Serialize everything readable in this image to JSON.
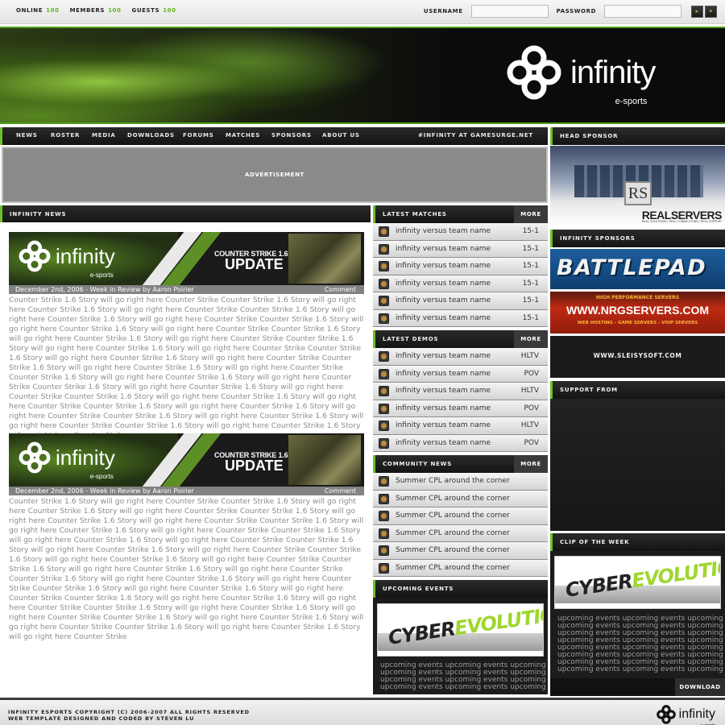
{
  "stats": {
    "online_label": "ONLINE",
    "online": "100",
    "members_label": "MEMBERS",
    "members": "100",
    "guests_label": "GUESTS",
    "guests": "100"
  },
  "login": {
    "username_label": "USERNAME",
    "password_label": "PASSWORD"
  },
  "brand": {
    "name": "infinity",
    "tagline": "e-sports"
  },
  "nav": {
    "items": [
      "NEWS",
      "ROSTER",
      "MEDIA",
      "DOWNLOADS",
      "FORUMS",
      "MATCHES",
      "SPONSORS",
      "ABOUT US"
    ],
    "irc": "#INFINITY AT GAMESURGE.NET"
  },
  "ad": {
    "label": "ADVERTISEMENT"
  },
  "news": {
    "header": "INFINITY NEWS",
    "story_banner": {
      "game": "COUNTER STRIKE 1.6",
      "kind": "UPDATE"
    },
    "stories": [
      {
        "meta": "December 2nd, 2006 - Week in Review by Aaron Poirier",
        "comment": "Comment"
      },
      {
        "meta": "December 2nd, 2006 - Week in Review by Aaron Poirier",
        "comment": "Comment"
      }
    ],
    "body": "Counter Strike 1.6 Story will go right here Counter Strike Counter Strike 1.6 Story will go right here Counter Strike 1.6 Story will go right here Counter Strike Counter Strike 1.6 Story will go right here Counter Strike 1.6 Story will go right here Counter Strike Counter Strike 1.6 Story will go right here Counter Strike 1.6 Story will go right here Counter Strike Counter Strike 1.6 Story will go right here Counter Strike 1.6 Story will go right here Counter Strike Counter Strike 1.6 Story will go right here Counter Strike 1.6 Story will go right here Counter Strike Counter Strike 1.6 Story will go right here Counter Strike 1.6 Story will go right here Counter Strike Counter Strike 1.6 Story will go right here Counter Strike 1.6 Story will go right here Counter Strike Counter Strike 1.6 Story will go right here Counter Strike 1.6 Story will go right here Counter Strike Counter Strike 1.6 Story will go right here Counter Strike 1.6 Story will go right here Counter Strike Counter Strike 1.6 Story will go right here Counter Strike 1.6 Story will go right here Counter Strike Counter Strike 1.6 Story will go right here Counter Strike 1.6 Story will go right here Counter Strike Counter Strike 1.6 Story will go right here Counter Strike 1.6 Story will go right here Counter Strike Counter Strike 1.6 Story will go right here Counter Strike 1.6 Story will go right here Counter Strike"
  },
  "matches": {
    "header": "LATEST MATCHES",
    "more": "MORE",
    "rows": [
      {
        "label": "infinity versus team name",
        "value": "15-1"
      },
      {
        "label": "infinity versus team name",
        "value": "15-1"
      },
      {
        "label": "infinity versus team name",
        "value": "15-1"
      },
      {
        "label": "infinity versus team name",
        "value": "15-1"
      },
      {
        "label": "infinity versus team name",
        "value": "15-1"
      },
      {
        "label": "infinity versus team name",
        "value": "15-1"
      }
    ]
  },
  "demos": {
    "header": "LATEST DEMOS",
    "more": "MORE",
    "rows": [
      {
        "label": "infinity versus team name",
        "value": "HLTV"
      },
      {
        "label": "infinity versus team name",
        "value": "POV"
      },
      {
        "label": "infinity versus team name",
        "value": "HLTV"
      },
      {
        "label": "infinity versus team name",
        "value": "POV"
      },
      {
        "label": "infinity versus team name",
        "value": "HLTV"
      },
      {
        "label": "infinity versus team name",
        "value": "POV"
      }
    ]
  },
  "community": {
    "header": "COMMUNITY NEWS",
    "more": "MORE",
    "rows": [
      {
        "label": "Summer CPL around the corner"
      },
      {
        "label": "Summer CPL around the corner"
      },
      {
        "label": "Summer CPL around the corner"
      },
      {
        "label": "Summer CPL around the corner"
      },
      {
        "label": "Summer CPL around the corner"
      },
      {
        "label": "Summer CPL around the corner"
      }
    ]
  },
  "events": {
    "header": "UPCOMING EVENTS",
    "image_text_a": "CYBER",
    "image_text_b": "EVOLUTION",
    "lines": [
      "upcoming events upcoming events upcoming",
      "upcoming events upcoming events upcoming",
      "upcoming events upcoming events upcoming",
      "upcoming events upcoming events upcoming"
    ]
  },
  "sidebar": {
    "head_sponsor": "HEAD SPONSOR",
    "head_sponsor_name": "REALSERVERS",
    "head_sponsor_tag": "REAL SOLUTIONS / REAL CONNECTIONS / REAL SUPPORT",
    "sponsors_header": "INFINITY SPONSORS",
    "battlepad": "BATTLEPAD",
    "nrg_top": "HIGH PERFORMANCE SERVERS",
    "nrg": "WWW.NRGSERVERS.COM",
    "nrg_sub": "WEB HOSTING - GAME SERVERS - VOIP SERVERS",
    "sleisy": "WWW.SLEISYSOFT.COM",
    "support_header": "SUPPORT FROM",
    "clip_header": "CLIP OF THE WEEK",
    "clip_lines": [
      "upcoming events upcoming events upcoming",
      "upcoming events upcoming events upcoming",
      "upcoming events upcoming events upcoming",
      "upcoming events upcoming events upcoming",
      "upcoming events upcoming events upcoming",
      "upcoming events upcoming events upcoming",
      "upcoming events upcoming events upcoming",
      "upcoming events upcoming events upcoming"
    ],
    "download": "DOWNLOAD"
  },
  "footer": {
    "line1": "INFINITY ESPORTS COPYRIGHT (C) 2006-2007 ALL RIGHTS RESERVED",
    "line2": "WEB TEMPLATE DESIGNED AND CODED BY STEVEN LU"
  },
  "colors": {
    "accent_green": "#6fbf2a",
    "dark": "#141414"
  }
}
